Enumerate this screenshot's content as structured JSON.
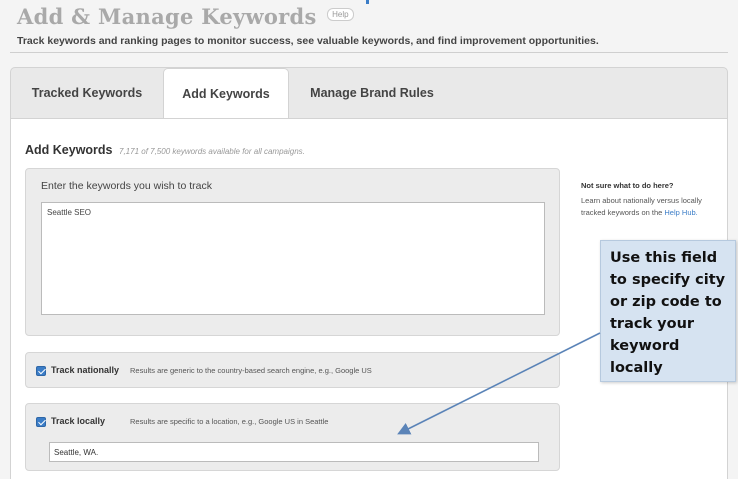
{
  "header": {
    "title": "Add & Manage Keywords",
    "help_label": "Help",
    "subtitle": "Track keywords and ranking pages to monitor success, see valuable keywords, and find improvement opportunities."
  },
  "tabs": [
    {
      "label": "Tracked Keywords",
      "active": false
    },
    {
      "label": "Add Keywords",
      "active": true
    },
    {
      "label": "Manage Brand Rules",
      "active": false
    }
  ],
  "add_keywords": {
    "title": "Add Keywords",
    "note": "7,171 of 7,500 keywords available for all campaigns.",
    "input_label": "Enter the keywords you wish to track",
    "keywords_value": "Seattle SEO"
  },
  "track_nationally": {
    "checked": true,
    "label": "Track nationally",
    "description": "Results are generic to the country-based search engine, e.g., Google US"
  },
  "track_locally": {
    "checked": true,
    "label": "Track locally",
    "description": "Results are specific to a location, e.g., Google US in Seattle",
    "location_value": "Seattle, WA."
  },
  "sidebar": {
    "title": "Not sure what to do here?",
    "text": "Learn about nationally versus locally tracked keywords on the",
    "link": "Help Hub."
  },
  "callout": {
    "text": "Use this field to specify city or zip code to track your keyword locally"
  },
  "colors": {
    "accent": "#3b7dc7",
    "callout_bg": "#d6e3f1",
    "title_gray": "#a9a9a9"
  }
}
